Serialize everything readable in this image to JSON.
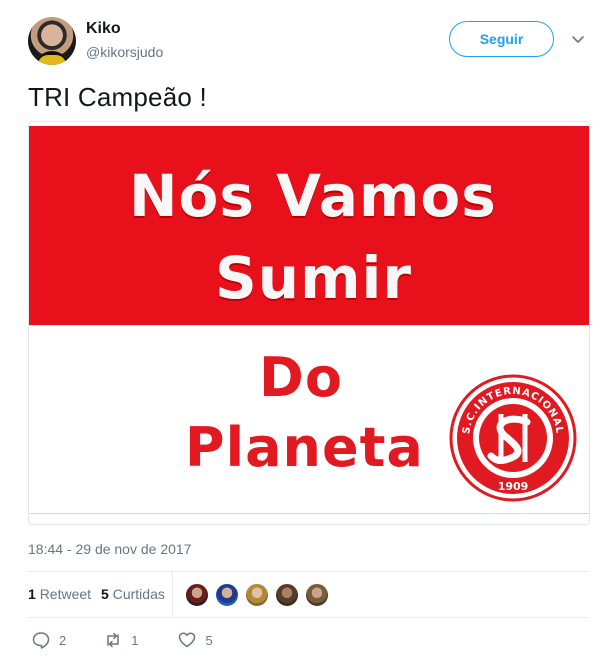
{
  "author": {
    "name": "Kiko",
    "handle": "@kikorsjudo"
  },
  "follow_label": "Seguir",
  "tweet_text": "TRI Campeão !",
  "media": {
    "line1": "Nós Vamos",
    "line2": "Sumir",
    "line3": "Do",
    "line4": "Planeta",
    "crest_text": "S.C.INTERNACIONAL",
    "crest_year": "1909"
  },
  "timestamp": "18:44 - 29 de nov de 2017",
  "stats": {
    "retweets_count": "1",
    "retweets_label": "Retweet",
    "likes_count": "5",
    "likes_label": "Curtidas"
  },
  "actions": {
    "reply_count": "2",
    "retweet_count": "1",
    "like_count": "5"
  },
  "colors": {
    "accent": "#1da1f2",
    "inter_red": "#e8111b",
    "muted": "#657786"
  },
  "icons": {
    "caret": "chevron-down-icon",
    "reply": "reply-icon",
    "retweet": "retweet-icon",
    "like": "heart-icon"
  }
}
